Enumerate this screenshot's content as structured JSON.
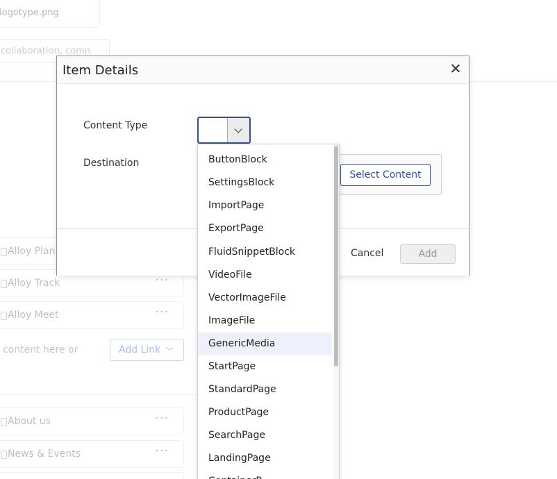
{
  "background": {
    "file_name": "logotype.png",
    "tags_input_value": "collaboration, comn",
    "link_items_top": [
      "Alloy Plan",
      "Alloy Track",
      "Alloy Meet"
    ],
    "drop_text": "content here or",
    "add_link_label": "Add Link",
    "link_items_bottom": [
      "About us",
      "News & Events"
    ],
    "more_icon": "···"
  },
  "dialog": {
    "title": "Item Details",
    "content_type_label": "Content Type",
    "destination_label": "Destination",
    "select_content_label": "Select Content",
    "cancel_label": "Cancel",
    "add_label": "Add"
  },
  "dropdown": {
    "options": [
      "ButtonBlock",
      "SettingsBlock",
      "ImportPage",
      "ExportPage",
      "FluidSnippetBlock",
      "VideoFile",
      "VectorImageFile",
      "ImageFile",
      "GenericMedia",
      "StartPage",
      "StandardPage",
      "ProductPage",
      "SearchPage",
      "LandingPage",
      "ContainerP..."
    ],
    "hovered_option": "GenericMedia"
  },
  "colors": {
    "accent": "#2f4fa3",
    "hover_bg": "#eef0fb"
  }
}
